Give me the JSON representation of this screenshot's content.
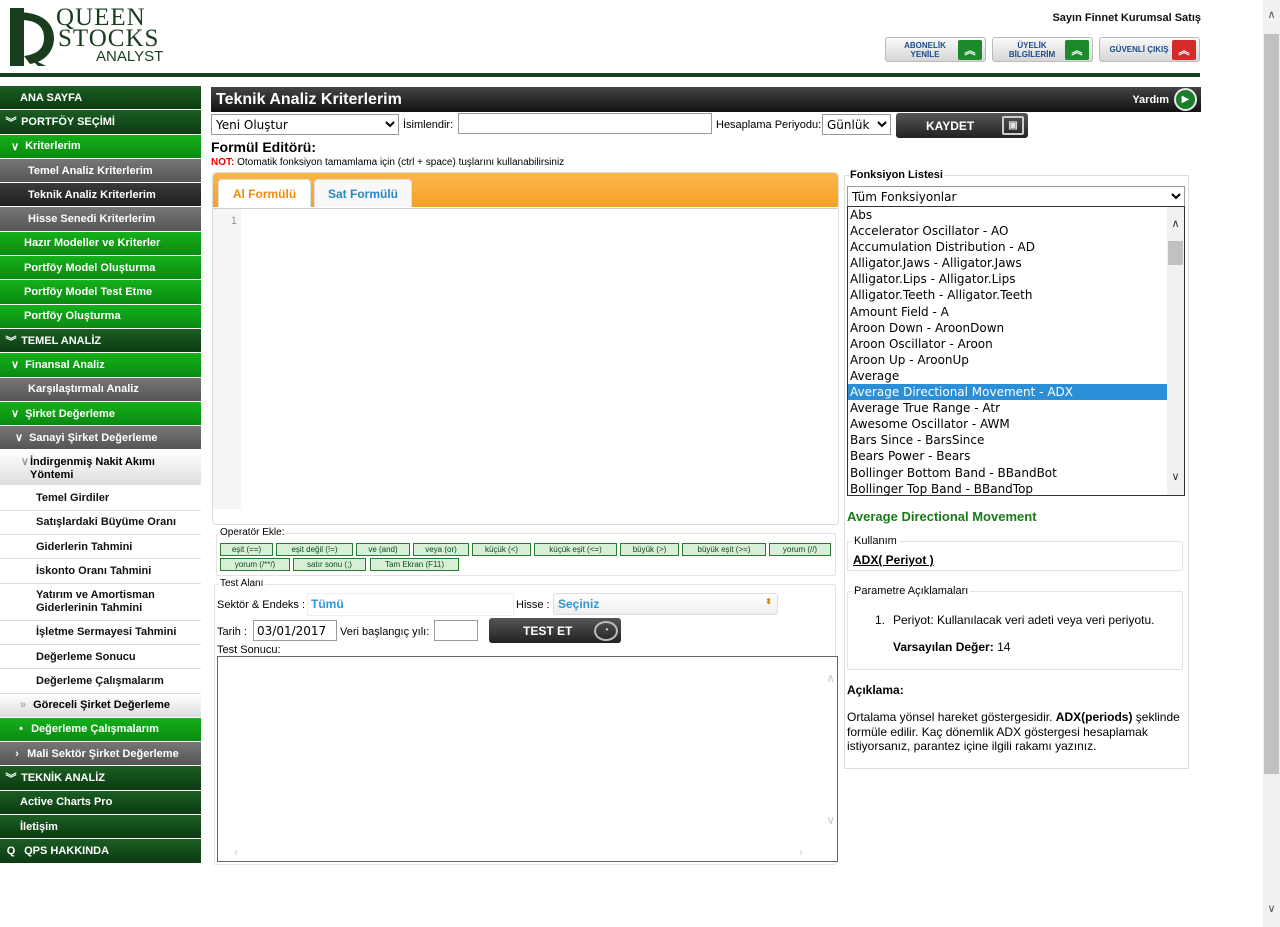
{
  "logo": {
    "line1": "QUEEN",
    "line2": "STOCKS",
    "line3": "ANALYST"
  },
  "header": {
    "user_name": "Sayın Finnet Kurumsal Satış",
    "buttons": [
      {
        "label": "ABONELİK YENİLE",
        "icon": "up-arrow-icon",
        "color": "#1a8a2a"
      },
      {
        "label": "ÜYELİK BİLGİLERİM",
        "icon": "up-arrow-icon",
        "color": "#1a8a2a"
      },
      {
        "label": "GÜVENLİ ÇIKIŞ",
        "icon": "up-arrow-icon",
        "color": "#d42a2a"
      }
    ]
  },
  "sidebar": {
    "items": [
      {
        "label": "ANA SAYFA"
      },
      {
        "label": "PORTFÖY SEÇİMİ"
      },
      {
        "label": "Kriterlerim"
      },
      {
        "label": "Temel Analiz Kriterlerim"
      },
      {
        "label": "Teknik Analiz Kriterlerim"
      },
      {
        "label": "Hisse Senedi Kriterlerim"
      },
      {
        "label": "Hazır Modeller ve Kriterler"
      },
      {
        "label": "Portföy Model Oluşturma"
      },
      {
        "label": "Portföy Model Test Etme"
      },
      {
        "label": "Portföy Oluşturma"
      },
      {
        "label": "TEMEL ANALİZ"
      },
      {
        "label": "Finansal Analiz"
      },
      {
        "label": "Karşılaştırmalı Analiz"
      },
      {
        "label": "Şirket Değerleme"
      },
      {
        "label": "Sanayi Şirket Değerleme"
      },
      {
        "label": "İndirgenmiş Nakit Akımı Yöntemi"
      },
      {
        "label": "Temel Girdiler"
      },
      {
        "label": "Satışlardaki Büyüme Oranı"
      },
      {
        "label": "Giderlerin Tahmini"
      },
      {
        "label": "İskonto Oranı Tahmini"
      },
      {
        "label": "Yatırım ve Amortisman Giderlerinin Tahmini"
      },
      {
        "label": "İşletme Sermayesi Tahmini"
      },
      {
        "label": "Değerleme Sonucu"
      },
      {
        "label": "Değerleme Çalışmalarım"
      },
      {
        "label": "Göreceli Şirket Değerleme"
      },
      {
        "label": "Değerleme Çalışmalarım"
      },
      {
        "label": "Mali Sektör Şirket Değerleme"
      },
      {
        "label": "TEKNİK ANALİZ"
      },
      {
        "label": "Active Charts Pro"
      },
      {
        "label": "İletişim"
      },
      {
        "label": "QPS HAKKINDA"
      }
    ]
  },
  "main": {
    "title": "Teknik Analiz Kriterlerim",
    "help_label": "Yardım",
    "formula_select": "Yeni Oluştur",
    "name_label": "İsimlendir:",
    "name_value": "",
    "period_label": "Hesaplama Periyodu:",
    "period_value": "Günlük",
    "save_label": "KAYDET",
    "editor_title": "Formül Editörü:",
    "note_prefix": "NOT:",
    "note_text": "Otomatik fonksiyon tamamlama için (ctrl + space) tuşlarını kullanabilirsiniz",
    "tabs": [
      "Al Formülü",
      "Sat Formülü"
    ],
    "line_number": "1"
  },
  "operators": {
    "legend": "Operatör Ekle:",
    "buttons": [
      "eşit (==)",
      "eşit değil (!=)",
      "ve (and)",
      "veya (or)",
      "küçük (<)",
      "küçük eşit (<=)",
      "büyük (>)",
      "büyük eşit (>=)",
      "yorum (//)",
      "yorum (/**/)",
      "satır sonu (;)",
      "Tam Ekran (F11)"
    ]
  },
  "test": {
    "legend": "Test Alanı",
    "sector_label": "Sektör & Endeks :",
    "sector_value": "Tümü",
    "stock_label": "Hisse :",
    "stock_value": "Seçiniz",
    "date_label": "Tarih :",
    "date_value": "03/01/2017",
    "start_year_label": "Veri başlangıç yılı:",
    "start_year_value": "",
    "test_button": "TEST ET",
    "result_label": "Test Sonucu:"
  },
  "functions": {
    "title": "Fonksiyon Listesi",
    "filter": "Tüm Fonksiyonlar",
    "items": [
      "Abs",
      "Accelerator Oscillator - AO",
      "Accumulation Distribution - AD",
      "Alligator.Jaws - Alligator.Jaws",
      "Alligator.Lips - Alligator.Lips",
      "Alligator.Teeth - Alligator.Teeth",
      "Amount Field - A",
      "Aroon Down - AroonDown",
      "Aroon Oscillator - Aroon",
      "Aroon Up - AroonUp",
      "Average",
      "Average Directional Movement - ADX",
      "Average True Range - Atr",
      "Awesome Oscillator - AWM",
      "Bars Since - BarsSince",
      "Bears Power - Bears",
      "Bollinger Bottom Band - BBandBot",
      "Bollinger Top Band - BBandTop"
    ],
    "selected_index": 11,
    "selected_name": "Average Directional Movement",
    "usage_legend": "Kullanım",
    "usage": "ADX( Periyot )",
    "params_legend": "Parametre Açıklamaları",
    "param_number": "1.",
    "param_text": "Periyot: Kullanılacak veri adeti veya veri periyotu.",
    "default_label": "Varsayılan Değer:",
    "default_value": "14",
    "desc_title": "Açıklama:",
    "desc_prefix": "Ortalama yönsel hareket göstergesidir.",
    "desc_bold": "ADX(periods)",
    "desc_suffix": "şeklinde formüle edilir. Kaç dönemlik ADX göstergesi hesaplamak istiyorsanız, parantez içine ilgili rakamı yazınız."
  }
}
